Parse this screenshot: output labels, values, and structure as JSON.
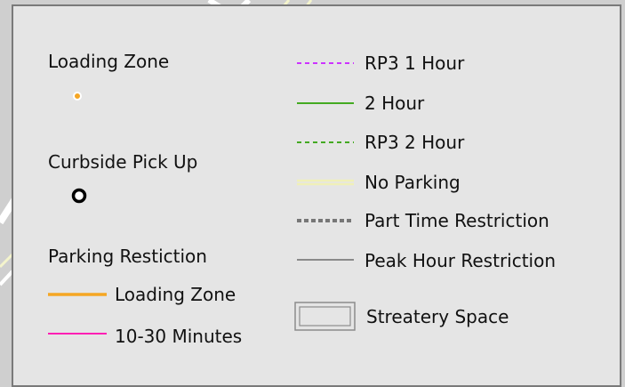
{
  "legend": {
    "left_column": {
      "loading_zone_label": "Loading Zone",
      "curbside_label": "Curbside Pick Up",
      "parking_restriction_label": "Parking Restiction",
      "loading_zone_line_label": "Loading Zone",
      "minutes_line_label": "10-30 Minutes"
    },
    "right_column": {
      "rp3_1hour_label": "RP3 1 Hour",
      "two_hour_label": "2 Hour",
      "rp3_2hour_label": "RP3 2 Hour",
      "no_parking_label": "No Parking",
      "part_time_label": "Part Time Restriction",
      "peak_hour_label": "Peak Hour Restriction",
      "streatery_label": "Streatery Space"
    }
  },
  "colors": {
    "panel_bg": "#e5e5e5",
    "panel_border": "#7a7a7a",
    "loading_zone": "#f5a623",
    "ten_thirty_minutes": "#ff1fb4",
    "rp3_1hour": "#cc33ff",
    "two_hour": "#44aa22",
    "rp3_2hour": "#44aa22",
    "no_parking": "#f0f0b8",
    "part_time": "#777777",
    "peak_hour": "#8a8a8a",
    "streatery_border": "#8c8c8c"
  }
}
